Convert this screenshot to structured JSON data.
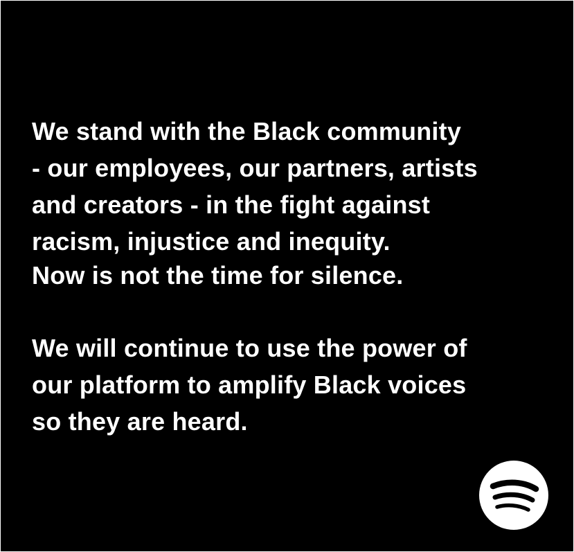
{
  "statement": {
    "paragraph_1": "We stand with the Black community\n- our employees, our partners, artists\nand creators - in the fight against\nracism, injustice and inequity.",
    "paragraph_2": "Now is not the time for silence.",
    "paragraph_3": "We will continue to use the power of\nour platform to amplify Black voices\nso they are heard."
  },
  "logo": {
    "icon": "spotify-logo-icon",
    "color": "#ffffff",
    "glyph_color": "#000000"
  },
  "colors": {
    "background": "#000000",
    "text": "#ffffff"
  }
}
